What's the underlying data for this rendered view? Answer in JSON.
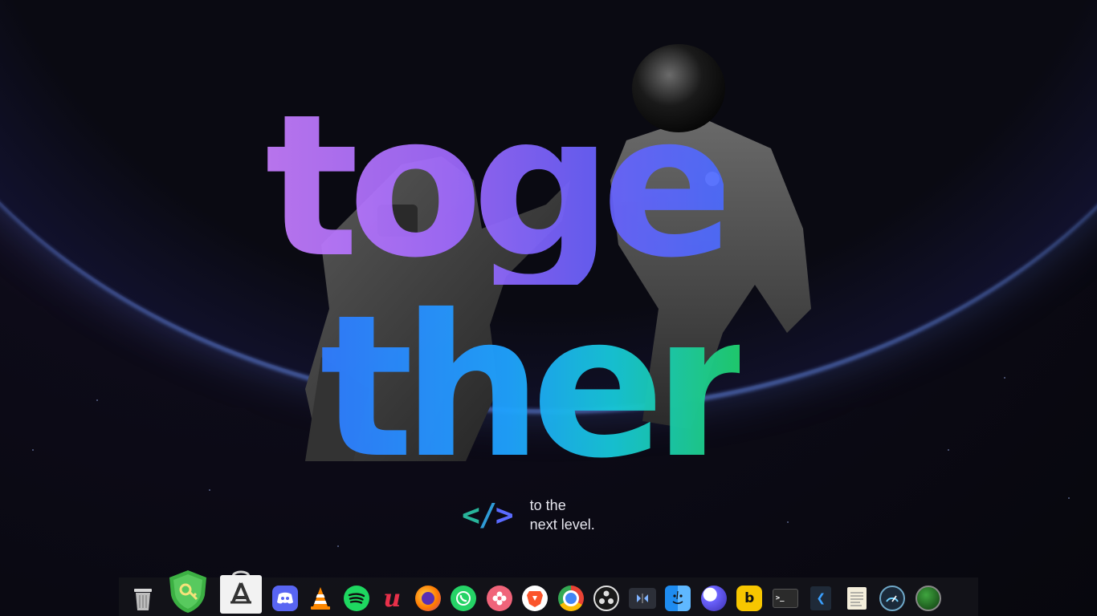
{
  "wallpaper": {
    "headline_top": "toge",
    "headline_bottom": "ther",
    "tagline_line1": "to the",
    "tagline_line2": "next level."
  },
  "dock": {
    "items": [
      {
        "name": "Trash",
        "icon": "trash-icon"
      },
      {
        "name": "Password Safe",
        "icon": "shield-key-icon"
      },
      {
        "name": "App Store",
        "icon": "app-store-bag-icon"
      },
      {
        "name": "Discord",
        "icon": "discord-icon"
      },
      {
        "name": "VLC",
        "icon": "vlc-cone-icon"
      },
      {
        "name": "Spotify",
        "icon": "spotify-icon"
      },
      {
        "name": "Unity",
        "icon": "script-u-icon"
      },
      {
        "name": "Firefox",
        "icon": "firefox-icon"
      },
      {
        "name": "WhatsApp",
        "icon": "whatsapp-icon"
      },
      {
        "name": "Flower App",
        "icon": "flower-icon"
      },
      {
        "name": "Brave",
        "icon": "brave-lion-icon"
      },
      {
        "name": "Chrome",
        "icon": "chrome-icon"
      },
      {
        "name": "OBS",
        "icon": "obs-icon"
      },
      {
        "name": "Video Editor",
        "icon": "film-editor-icon"
      },
      {
        "name": "Files",
        "icon": "finder-face-icon"
      },
      {
        "name": "Moon App",
        "icon": "moon-icon"
      },
      {
        "name": "Bitcoin Wallet",
        "icon": "hex-b-icon"
      },
      {
        "name": "Terminal",
        "icon": "terminal-icon"
      },
      {
        "name": "VS Code",
        "icon": "code-editor-icon"
      },
      {
        "name": "Text Editor",
        "icon": "notepad-icon"
      },
      {
        "name": "Speed Test",
        "icon": "gauge-icon"
      },
      {
        "name": "Green Orb",
        "icon": "green-orb-icon"
      }
    ]
  }
}
